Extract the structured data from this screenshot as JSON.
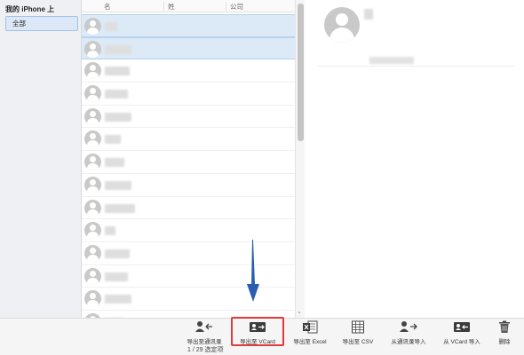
{
  "sidebar": {
    "title": "我的 iPhone 上",
    "items": [
      {
        "label": "全部"
      }
    ]
  },
  "list": {
    "columns": [
      "名",
      "姓",
      "公司"
    ],
    "rows": [
      {
        "selected": true
      },
      {
        "selected": true
      },
      {
        "selected": false
      },
      {
        "selected": false
      },
      {
        "selected": false
      },
      {
        "selected": false
      },
      {
        "selected": false
      },
      {
        "selected": false
      },
      {
        "selected": false
      },
      {
        "selected": false
      },
      {
        "selected": false
      },
      {
        "selected": false
      },
      {
        "selected": false
      },
      {
        "selected": false
      }
    ]
  },
  "toolbar": {
    "buttons": [
      {
        "label": "导出至通讯录",
        "icon": "export-contacts-icon"
      },
      {
        "label": "导出至 VCard",
        "icon": "export-vcard-icon"
      },
      {
        "label": "导出至 Excel",
        "icon": "export-excel-icon"
      },
      {
        "label": "导出至 CSV",
        "icon": "export-csv-icon"
      },
      {
        "label": "从通讯录导入",
        "icon": "import-contacts-icon"
      },
      {
        "label": "从 VCard 导入",
        "icon": "import-vcard-icon"
      },
      {
        "label": "删除",
        "icon": "trash-icon"
      }
    ]
  },
  "status": {
    "text": "1 / 29 选定项"
  },
  "colors": {
    "selection": "#dceaf7",
    "highlight_box": "#e03a3a",
    "arrow": "#2a5fb0"
  }
}
